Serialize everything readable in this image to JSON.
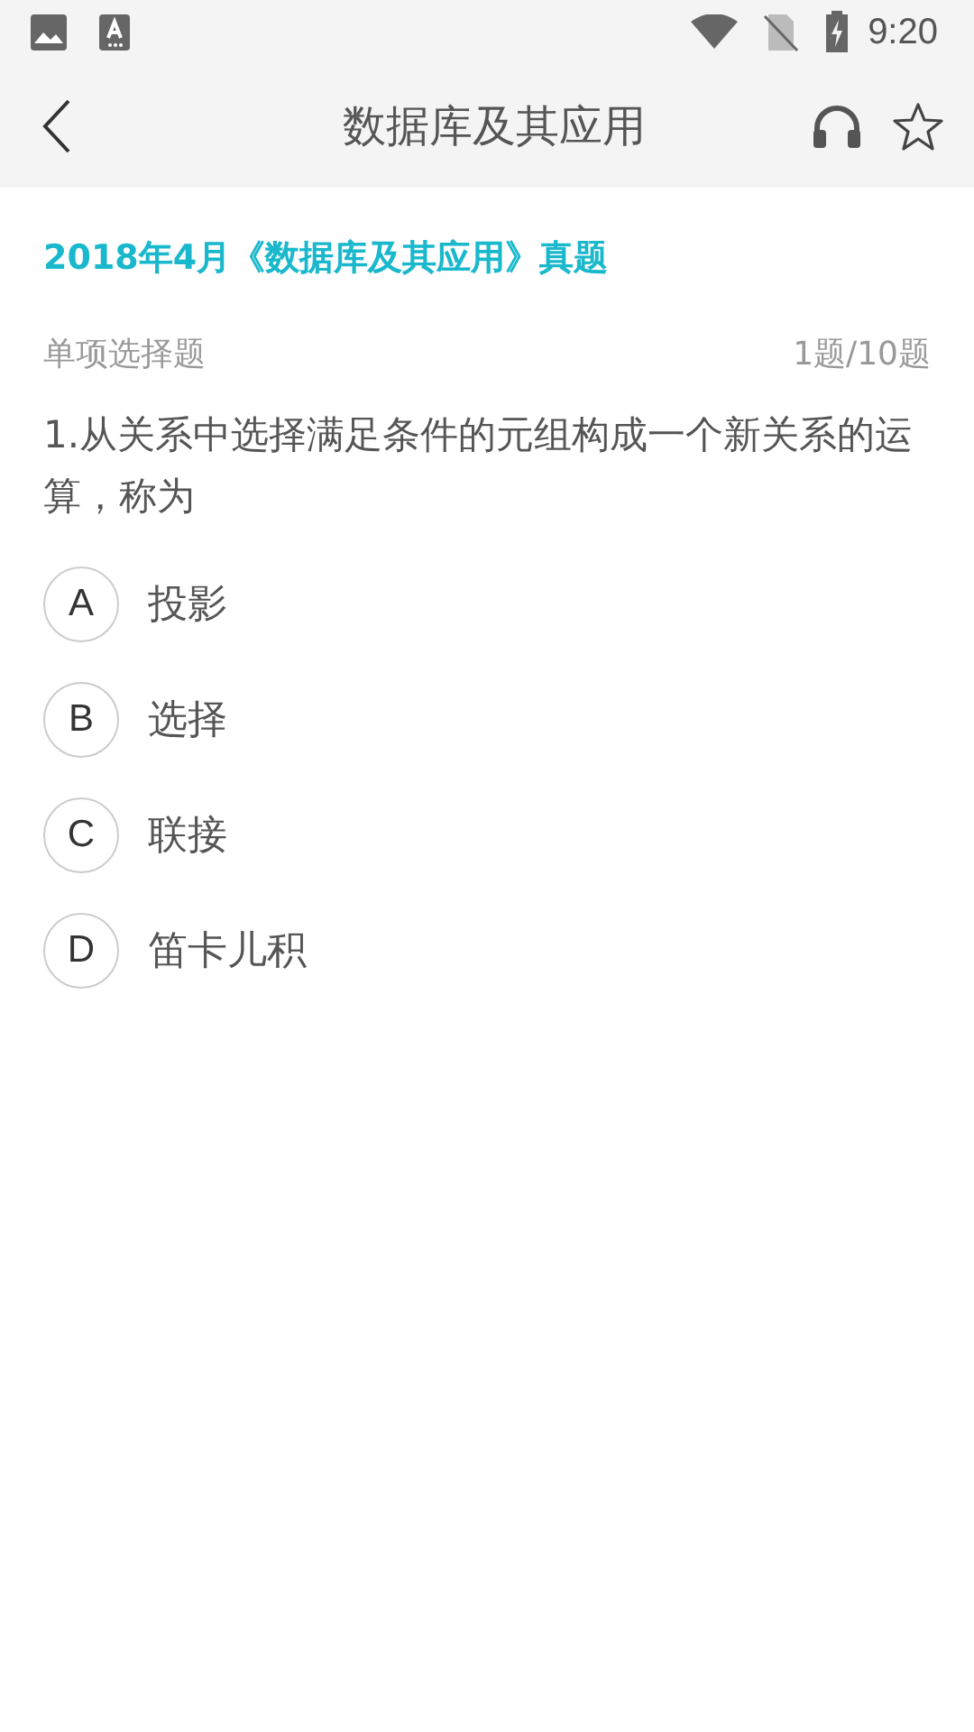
{
  "status_bar": {
    "time": "9:20"
  },
  "header": {
    "title": "数据库及其应用"
  },
  "exam_title": "2018年4月《数据库及其应用》真题",
  "question_type": "单项选择题",
  "progress": "1题/10题",
  "question": "1.从关系中选择满足条件的元组构成一个新关系的运算，称为",
  "options": [
    {
      "letter": "A",
      "text": "投影",
      "selected": false
    },
    {
      "letter": "B",
      "text": "选择",
      "selected": false
    },
    {
      "letter": "C",
      "text": "联接",
      "selected": false
    },
    {
      "letter": "D",
      "text": "笛卡儿积",
      "selected": false
    }
  ]
}
